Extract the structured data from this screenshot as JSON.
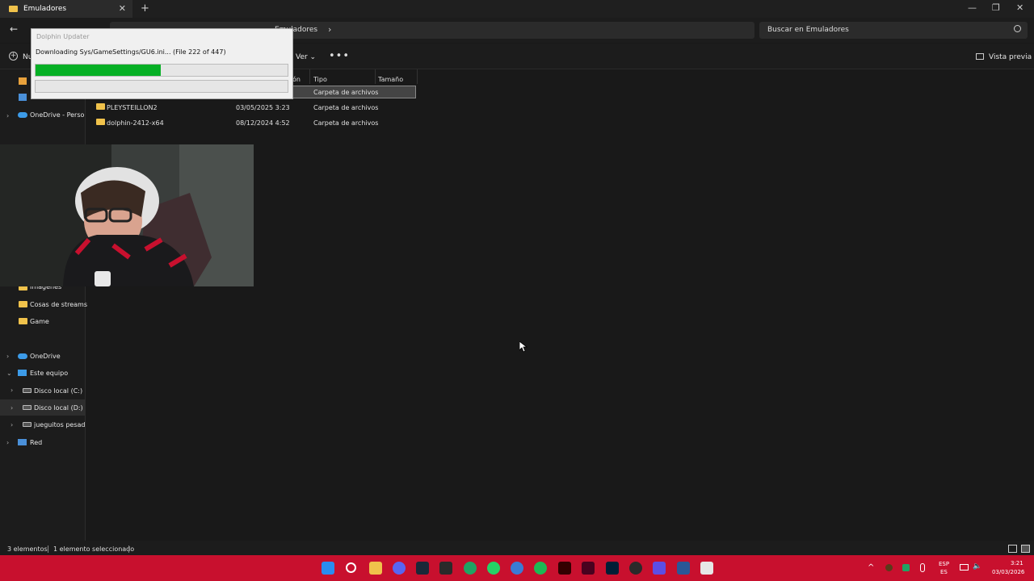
{
  "window": {
    "tab_title": "Emuladores",
    "new_tab": "+",
    "close": "✕",
    "minimize": "—",
    "maximize": "❐"
  },
  "nav": {
    "back": "←",
    "address_current": "Emuladores",
    "address_chevron": "›",
    "search_placeholder": "Buscar en Emuladores"
  },
  "toolbar": {
    "new_label": "Nu",
    "view_label": "Ver ⌄",
    "more": "•••",
    "preview_label": "Vista previa"
  },
  "sidebar": {
    "items": [
      {
        "label": "OneDrive - Persona"
      },
      {
        "label": "Imágenes"
      },
      {
        "label": "Cosas de streams"
      },
      {
        "label": "Game"
      },
      {
        "label": "OneDrive"
      },
      {
        "label": "Este equipo"
      },
      {
        "label": "Disco local (C:)"
      },
      {
        "label": "Disco local (D:)"
      },
      {
        "label": "jueguitos pesadit"
      },
      {
        "label": "Red"
      }
    ]
  },
  "columns": {
    "date_partial": "ón",
    "type": "Tipo",
    "size": "Tamaño"
  },
  "files": [
    {
      "name": "",
      "date": "",
      "type": "Carpeta de archivos"
    },
    {
      "name": "PLEYSTEILLON2",
      "date": "03/05/2025 3:23",
      "type": "Carpeta de archivos"
    },
    {
      "name": "dolphin-2412-x64",
      "date": "08/12/2024 4:52",
      "type": "Carpeta de archivos"
    }
  ],
  "updater": {
    "title": "Dolphin Updater",
    "status": "Downloading Sys/GameSettings/GU6.ini... (File 222 of 447)",
    "progress_fraction": 0.496
  },
  "status": {
    "count": "3 elementos",
    "selected": "1 elemento seleccionado"
  },
  "taskbar": {
    "lang": "ESP",
    "region": "ES",
    "time": "3:21",
    "date": "03/03/2026",
    "colors": {
      "bar": "#c8102e"
    }
  }
}
